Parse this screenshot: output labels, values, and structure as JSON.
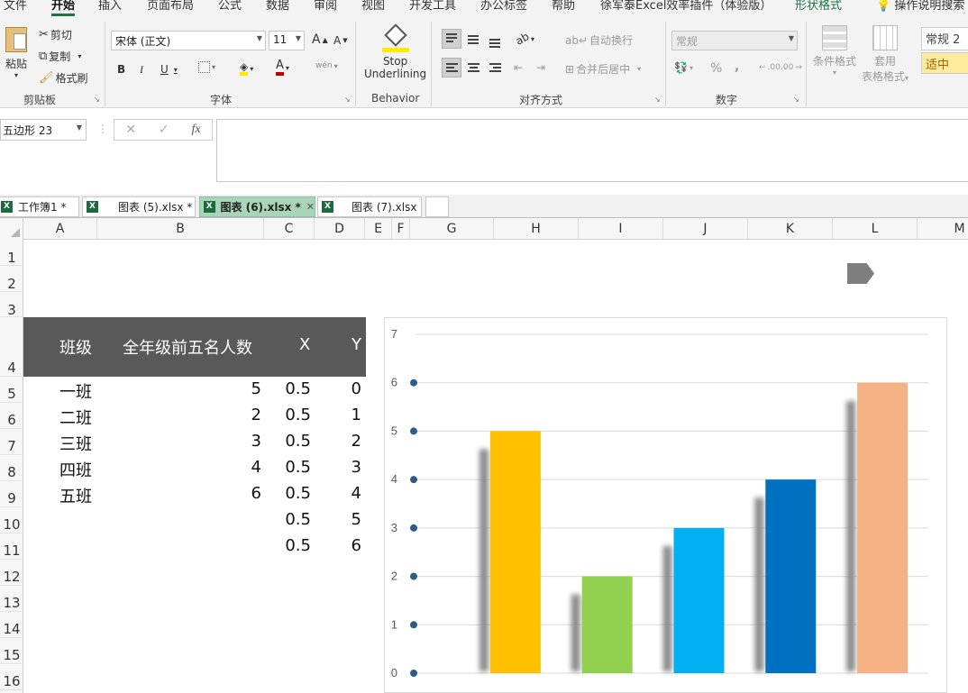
{
  "menu": {
    "items": [
      "文件",
      "开始",
      "插入",
      "页面布局",
      "公式",
      "数据",
      "审阅",
      "视图",
      "开发工具",
      "办公标签",
      "帮助",
      "徐军泰Excel效率插件（体验版）",
      "形状格式",
      "操作说明搜索"
    ],
    "active_index": 1
  },
  "ribbon": {
    "clipboard": {
      "paste": "粘贴",
      "cut": "剪切",
      "copy": "复制",
      "format_painter": "格式刷",
      "label": "剪贴板"
    },
    "font": {
      "name": "宋体 (正文)",
      "size": "11",
      "bold": "B",
      "italic": "I",
      "underline": "U",
      "label": "字体",
      "grow": "A",
      "shrink": "A",
      "font_color": "A",
      "phonetic": "wén"
    },
    "behavior": {
      "line1": "Stop",
      "line2": "Underlining",
      "label": "Behavior"
    },
    "alignment": {
      "wrap": "自动换行",
      "merge": "合并后居中",
      "label": "对齐方式"
    },
    "number": {
      "format": "常规",
      "percent": "%",
      "comma": ",",
      "inc_decimal": ".00",
      "dec_decimal": ".00",
      "label": "数字"
    },
    "styles": {
      "conditional": "条件格式",
      "table1": "套用",
      "table2": "表格格式",
      "normal": "常规",
      "medium": "适中",
      "normal_suffix": "2"
    }
  },
  "formula_bar": {
    "name_box": "五边形 23",
    "fx": "fx",
    "cancel": "✕",
    "enter": "✓"
  },
  "workbook_tabs": [
    {
      "label": "工作簿1 *",
      "active": false
    },
    {
      "label": "图表 (5).xlsx *",
      "active": false
    },
    {
      "label": "图表 (6).xlsx *",
      "active": true
    },
    {
      "label": "图表 (7).xlsx",
      "active": false
    }
  ],
  "columns": [
    "A",
    "B",
    "C",
    "D",
    "E",
    "F",
    "G",
    "H",
    "I",
    "J",
    "K",
    "L",
    "M"
  ],
  "rows": [
    "1",
    "2",
    "3",
    "4",
    "5",
    "6",
    "7",
    "8",
    "9",
    "10",
    "11",
    "12",
    "13",
    "14",
    "15",
    "16"
  ],
  "table": {
    "headers": [
      "班级",
      "全年级前五名人数",
      "X",
      "Y"
    ],
    "rows": [
      [
        "一班",
        "5",
        "0.5",
        "0"
      ],
      [
        "二班",
        "2",
        "0.5",
        "1"
      ],
      [
        "三班",
        "3",
        "0.5",
        "2"
      ],
      [
        "四班",
        "4",
        "0.5",
        "3"
      ],
      [
        "五班",
        "6",
        "0.5",
        "4"
      ],
      [
        "",
        "",
        "0.5",
        "5"
      ],
      [
        "",
        "",
        "0.5",
        "6"
      ]
    ]
  },
  "chart_data": {
    "type": "bar",
    "categories": [
      "一班",
      "二班",
      "三班",
      "四班",
      "五班"
    ],
    "values": [
      5,
      2,
      3,
      4,
      6
    ],
    "colors": [
      "#FFC000",
      "#92D050",
      "#00B0F0",
      "#0070C0",
      "#F4B183"
    ],
    "shadow_color": "#7f7f7f",
    "title": "",
    "xlabel": "",
    "ylabel": "",
    "ylim": [
      0,
      7
    ],
    "yticks": [
      0,
      1,
      2,
      3,
      4,
      5,
      6,
      7
    ],
    "scatter": {
      "x": [
        0.5,
        0.5,
        0.5,
        0.5,
        0.5,
        0.5,
        0.5
      ],
      "y": [
        0,
        1,
        2,
        3,
        4,
        5,
        6
      ],
      "color": "#2E5C8A"
    },
    "grid": true,
    "legend": "none"
  }
}
